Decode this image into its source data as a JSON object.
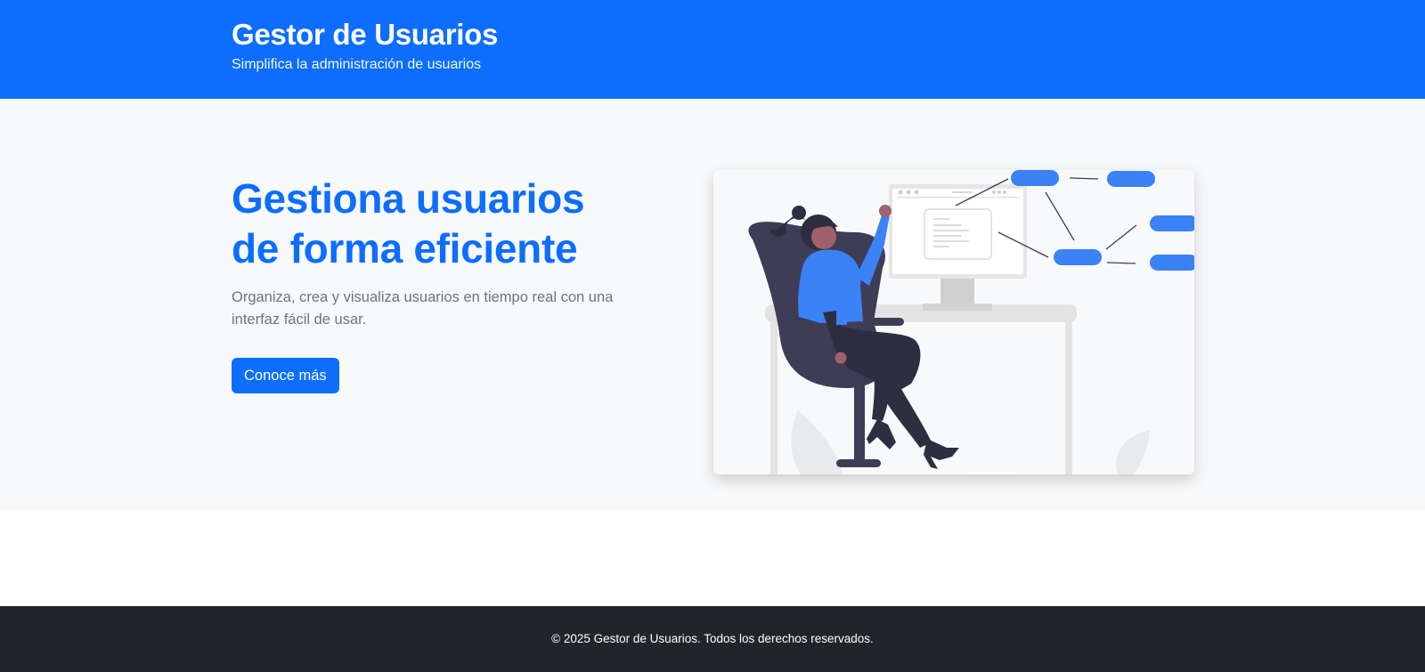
{
  "header": {
    "title": "Gestor de Usuarios",
    "tagline": "Simplifica la administración de usuarios"
  },
  "hero": {
    "title_line1": "Gestiona usuarios",
    "title_line2": "de forma eficiente",
    "lead": "Organiza, crea y visualiza usuarios en tiempo real con una interfaz fácil de usar.",
    "cta_label": "Conoce más"
  },
  "illustration": {
    "icon": "woman-at-desk-illustration",
    "accent_color": "#3b82f6"
  },
  "footer": {
    "text": "© 2025 Gestor de Usuarios. Todos los derechos reservados."
  },
  "colors": {
    "primary": "#0d6efd",
    "light_bg": "#f8f9fa",
    "dark_footer": "#212529",
    "muted_text": "#6c757d"
  }
}
